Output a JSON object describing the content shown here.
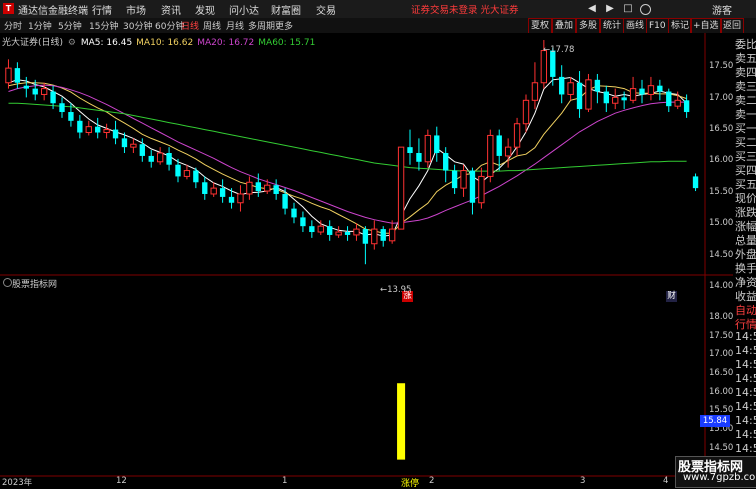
{
  "app": {
    "name": "通达信金融终端",
    "logo": "T"
  },
  "menu": [
    "行情",
    "市场",
    "资讯",
    "发现",
    "问小达",
    "财富圈",
    "交易"
  ],
  "notice": "证券交易未登录  光大证券",
  "window_controls": {
    "nav_back": "◀",
    "nav_fwd": "▶",
    "box": "□",
    "user": "游客"
  },
  "periods": [
    "分时",
    "1分钟",
    "5分钟",
    "15分钟",
    "30分钟",
    "60分钟",
    "日线",
    "周线",
    "月线",
    "多周期",
    "更多"
  ],
  "active_period": "日线",
  "right_tabs": [
    "夏权",
    "叠加",
    "多股",
    "统计",
    "画线",
    "F10",
    "标记",
    "+自选",
    "返回"
  ],
  "stock": {
    "title": "光大证券(日线)"
  },
  "ma_legend": [
    {
      "label": "MA5: 16.45",
      "color": "#ffffff"
    },
    {
      "label": "MA10: 16.62",
      "color": "#f0d060"
    },
    {
      "label": "MA20: 16.72",
      "color": "#cc44cc"
    },
    {
      "label": "MA60: 15.71",
      "color": "#33cc33"
    }
  ],
  "indicator": {
    "title": "股票指标网",
    "signal_label": "涨停"
  },
  "markers": {
    "high": "17.78",
    "low": "13.95",
    "up_flag": "涨",
    "fin_flag": "财"
  },
  "price_axis": [
    "17.50",
    "17.00",
    "16.50",
    "16.00",
    "15.50",
    "15.00",
    "14.50",
    "14.00"
  ],
  "indicator_axis": [
    "18.00",
    "17.50",
    "17.00",
    "16.50",
    "16.00",
    "15.50",
    "15.00",
    "14.50"
  ],
  "indicator_current": "15.84",
  "right_panel": [
    "委比",
    "卖五",
    "卖四",
    "卖三",
    "卖二",
    "卖一",
    "买一",
    "买二",
    "买三",
    "买四",
    "买五",
    "现价",
    "涨跌",
    "涨幅",
    "总量",
    "外盘",
    "换手",
    "净资",
    "收益",
    "自动",
    "行情",
    "14:5",
    "14:5",
    "14:5",
    "14:5",
    "14:5",
    "14:5",
    "14:5",
    "14:5",
    "14:5",
    "14:5"
  ],
  "x_axis": [
    "2023年",
    "12",
    "1",
    "2",
    "3",
    "4"
  ],
  "watermark": {
    "line1": "股票指标网",
    "line2": "www.7gpzb.com"
  },
  "colors": {
    "up": "#ff3232",
    "down": "#00ffff",
    "signal": "#ffff00",
    "menu_bg": "#1b1b1b",
    "active": "#ff4040"
  },
  "chart_data": {
    "type": "candlestick",
    "ylim": [
      13.8,
      17.9
    ],
    "up_color": "#ff3232",
    "down_color": "#00ffff",
    "candles": [
      [
        17.05,
        17.3,
        17.45,
        16.95
      ],
      [
        17.3,
        17.05,
        17.4,
        16.95
      ],
      [
        17.0,
        16.95,
        17.15,
        16.8
      ],
      [
        16.95,
        16.85,
        17.1,
        16.75
      ],
      [
        16.85,
        16.95,
        17.05,
        16.75
      ],
      [
        16.9,
        16.7,
        17.0,
        16.6
      ],
      [
        16.7,
        16.55,
        16.8,
        16.45
      ],
      [
        16.55,
        16.4,
        16.7,
        16.3
      ],
      [
        16.4,
        16.2,
        16.5,
        16.1
      ],
      [
        16.2,
        16.3,
        16.4,
        16.15
      ],
      [
        16.3,
        16.2,
        16.45,
        16.1
      ],
      [
        16.2,
        16.25,
        16.35,
        16.1
      ],
      [
        16.25,
        16.1,
        16.4,
        16.0
      ],
      [
        16.1,
        15.95,
        16.2,
        15.85
      ],
      [
        15.95,
        16.0,
        16.1,
        15.85
      ],
      [
        16.0,
        15.8,
        16.1,
        15.7
      ],
      [
        15.8,
        15.7,
        15.9,
        15.6
      ],
      [
        15.7,
        15.85,
        15.95,
        15.65
      ],
      [
        15.85,
        15.65,
        15.95,
        15.55
      ],
      [
        15.65,
        15.45,
        15.75,
        15.35
      ],
      [
        15.45,
        15.55,
        15.65,
        15.4
      ],
      [
        15.55,
        15.35,
        15.6,
        15.25
      ],
      [
        15.35,
        15.15,
        15.45,
        15.05
      ],
      [
        15.15,
        15.25,
        15.35,
        15.1
      ],
      [
        15.25,
        15.1,
        15.4,
        15.0
      ],
      [
        15.1,
        15.0,
        15.25,
        14.9
      ],
      [
        15.0,
        15.15,
        15.3,
        14.85
      ],
      [
        15.15,
        15.35,
        15.45,
        15.05
      ],
      [
        15.35,
        15.2,
        15.5,
        15.1
      ],
      [
        15.2,
        15.3,
        15.4,
        15.15
      ],
      [
        15.3,
        15.15,
        15.4,
        15.05
      ],
      [
        15.15,
        14.9,
        15.25,
        14.8
      ],
      [
        14.9,
        14.75,
        15.0,
        14.65
      ],
      [
        14.75,
        14.6,
        14.85,
        14.5
      ],
      [
        14.6,
        14.5,
        14.7,
        14.4
      ],
      [
        14.5,
        14.6,
        14.7,
        14.45
      ],
      [
        14.6,
        14.45,
        14.7,
        14.35
      ],
      [
        14.45,
        14.5,
        14.6,
        14.4
      ],
      [
        14.5,
        14.45,
        14.6,
        14.35
      ],
      [
        14.45,
        14.55,
        14.65,
        14.35
      ],
      [
        14.55,
        14.3,
        14.6,
        13.95
      ],
      [
        14.3,
        14.55,
        14.7,
        14.2
      ],
      [
        14.55,
        14.35,
        14.6,
        14.25
      ],
      [
        14.35,
        14.55,
        14.7,
        14.3
      ],
      [
        14.55,
        15.95,
        15.95,
        14.55
      ],
      [
        15.95,
        15.85,
        16.25,
        15.65
      ],
      [
        15.85,
        15.7,
        16.1,
        15.55
      ],
      [
        15.7,
        16.15,
        16.25,
        15.6
      ],
      [
        16.15,
        15.85,
        16.3,
        15.7
      ],
      [
        15.85,
        15.55,
        15.95,
        15.35
      ],
      [
        15.55,
        15.25,
        15.65,
        15.15
      ],
      [
        15.25,
        15.55,
        15.65,
        15.1
      ],
      [
        15.55,
        15.0,
        15.6,
        14.8
      ],
      [
        15.0,
        15.45,
        15.6,
        14.9
      ],
      [
        15.45,
        16.15,
        16.25,
        15.35
      ],
      [
        16.15,
        15.8,
        16.25,
        15.55
      ],
      [
        15.8,
        15.95,
        16.1,
        15.6
      ],
      [
        15.95,
        16.35,
        16.45,
        15.8
      ],
      [
        16.35,
        16.75,
        16.85,
        16.2
      ],
      [
        16.75,
        17.05,
        17.4,
        16.6
      ],
      [
        17.05,
        17.6,
        17.78,
        16.95
      ],
      [
        17.6,
        17.15,
        17.65,
        17.0
      ],
      [
        17.15,
        16.85,
        17.35,
        16.7
      ],
      [
        16.85,
        17.05,
        17.15,
        16.75
      ],
      [
        17.05,
        16.6,
        17.25,
        16.45
      ],
      [
        16.6,
        17.1,
        17.2,
        16.55
      ],
      [
        17.1,
        16.9,
        17.2,
        16.7
      ],
      [
        16.9,
        16.7,
        17.0,
        16.55
      ],
      [
        16.7,
        16.8,
        16.95,
        16.6
      ],
      [
        16.8,
        16.75,
        16.9,
        16.6
      ],
      [
        16.75,
        16.95,
        17.15,
        16.7
      ],
      [
        16.95,
        16.85,
        17.1,
        16.7
      ],
      [
        16.85,
        17.0,
        17.15,
        16.75
      ],
      [
        17.0,
        16.9,
        17.1,
        16.75
      ],
      [
        16.9,
        16.65,
        16.95,
        16.55
      ],
      [
        16.65,
        16.75,
        16.9,
        16.6
      ],
      [
        16.75,
        16.55,
        16.85,
        16.45
      ],
      [
        15.45,
        15.25,
        15.5,
        15.2
      ]
    ],
    "ma": [
      {
        "name": "MA5",
        "color": "#ffffff",
        "values": [
          17.05,
          17.1,
          17.08,
          17.02,
          16.98,
          16.9,
          16.82,
          16.7,
          16.56,
          16.43,
          16.33,
          16.27,
          16.21,
          16.16,
          16.1,
          16.02,
          15.92,
          15.86,
          15.8,
          15.7,
          15.64,
          15.57,
          15.44,
          15.34,
          15.28,
          15.2,
          15.14,
          15.17,
          15.18,
          15.2,
          15.26,
          15.19,
          15.06,
          14.93,
          14.77,
          14.64,
          14.58,
          14.53,
          14.51,
          14.51,
          14.45,
          14.47,
          14.43,
          14.45,
          14.78,
          15.07,
          15.29,
          15.55,
          15.93,
          15.82,
          15.7,
          15.66,
          15.45,
          15.35,
          15.48,
          15.59,
          15.74,
          15.96,
          16.21,
          16.53,
          16.94,
          17.1,
          17.12,
          17.14,
          17.05,
          16.95,
          16.9,
          16.87,
          16.82,
          16.85,
          16.82,
          16.85,
          16.87,
          16.91,
          16.87,
          16.85,
          16.7
        ]
      },
      {
        "name": "MA10",
        "color": "#f0d060",
        "values": [
          17.0,
          17.03,
          17.05,
          17.05,
          17.04,
          17.01,
          16.96,
          16.89,
          16.79,
          16.7,
          16.62,
          16.55,
          16.45,
          16.36,
          16.27,
          16.17,
          16.1,
          16.04,
          15.98,
          15.9,
          15.83,
          15.75,
          15.65,
          15.57,
          15.49,
          15.42,
          15.35,
          15.31,
          15.26,
          15.24,
          15.23,
          15.17,
          15.11,
          15.06,
          14.99,
          14.93,
          14.88,
          14.8,
          14.72,
          14.64,
          14.55,
          14.52,
          14.48,
          14.48,
          14.65,
          14.76,
          14.88,
          14.99,
          15.19,
          15.3,
          15.38,
          15.48,
          15.5,
          15.64,
          15.7,
          15.64,
          15.72,
          15.8,
          15.83,
          15.94,
          16.17,
          16.35,
          16.53,
          16.75,
          16.79,
          16.93,
          17.0,
          16.99,
          16.98,
          16.95,
          16.88,
          16.87,
          16.87,
          16.86,
          16.86,
          16.83,
          16.78
        ]
      },
      {
        "name": "MA20",
        "color": "#cc44cc",
        "values": [
          16.9,
          16.95,
          16.98,
          17.0,
          17.01,
          17.0,
          16.97,
          16.93,
          16.88,
          16.82,
          16.75,
          16.68,
          16.6,
          16.52,
          16.44,
          16.36,
          16.28,
          16.2,
          16.12,
          16.04,
          15.97,
          15.9,
          15.83,
          15.76,
          15.68,
          15.6,
          15.53,
          15.47,
          15.41,
          15.36,
          15.31,
          15.26,
          15.21,
          15.15,
          15.09,
          15.03,
          14.97,
          14.91,
          14.85,
          14.8,
          14.75,
          14.71,
          14.68,
          14.65,
          14.66,
          14.68,
          14.7,
          14.74,
          14.8,
          14.87,
          14.93,
          14.99,
          15.05,
          15.12,
          15.2,
          15.28,
          15.37,
          15.46,
          15.56,
          15.66,
          15.77,
          15.88,
          15.99,
          16.1,
          16.21,
          16.3,
          16.39,
          16.46,
          16.53,
          16.58,
          16.62,
          16.66,
          16.69,
          16.71,
          16.72,
          16.72,
          16.72
        ]
      },
      {
        "name": "MA60",
        "color": "#33cc33",
        "values": [
          16.7,
          16.7,
          16.69,
          16.68,
          16.67,
          16.66,
          16.65,
          16.64,
          16.62,
          16.6,
          16.58,
          16.56,
          16.54,
          16.52,
          16.49,
          16.46,
          16.43,
          16.4,
          16.37,
          16.34,
          16.31,
          16.28,
          16.25,
          16.22,
          16.19,
          16.16,
          16.13,
          16.1,
          16.07,
          16.04,
          16.01,
          15.98,
          15.95,
          15.92,
          15.89,
          15.86,
          15.83,
          15.8,
          15.77,
          15.74,
          15.71,
          15.68,
          15.66,
          15.64,
          15.62,
          15.6,
          15.59,
          15.58,
          15.57,
          15.56,
          15.55,
          15.54,
          15.54,
          15.54,
          15.54,
          15.54,
          15.55,
          15.55,
          15.56,
          15.57,
          15.58,
          15.59,
          15.6,
          15.61,
          15.62,
          15.63,
          15.64,
          15.65,
          15.66,
          15.67,
          15.68,
          15.69,
          15.7,
          15.7,
          15.71,
          15.71,
          15.71
        ]
      }
    ],
    "indicator": {
      "type": "bar",
      "signal_index": 44,
      "ylim": [
        14.5,
        18.0
      ],
      "value": 15.84
    }
  }
}
